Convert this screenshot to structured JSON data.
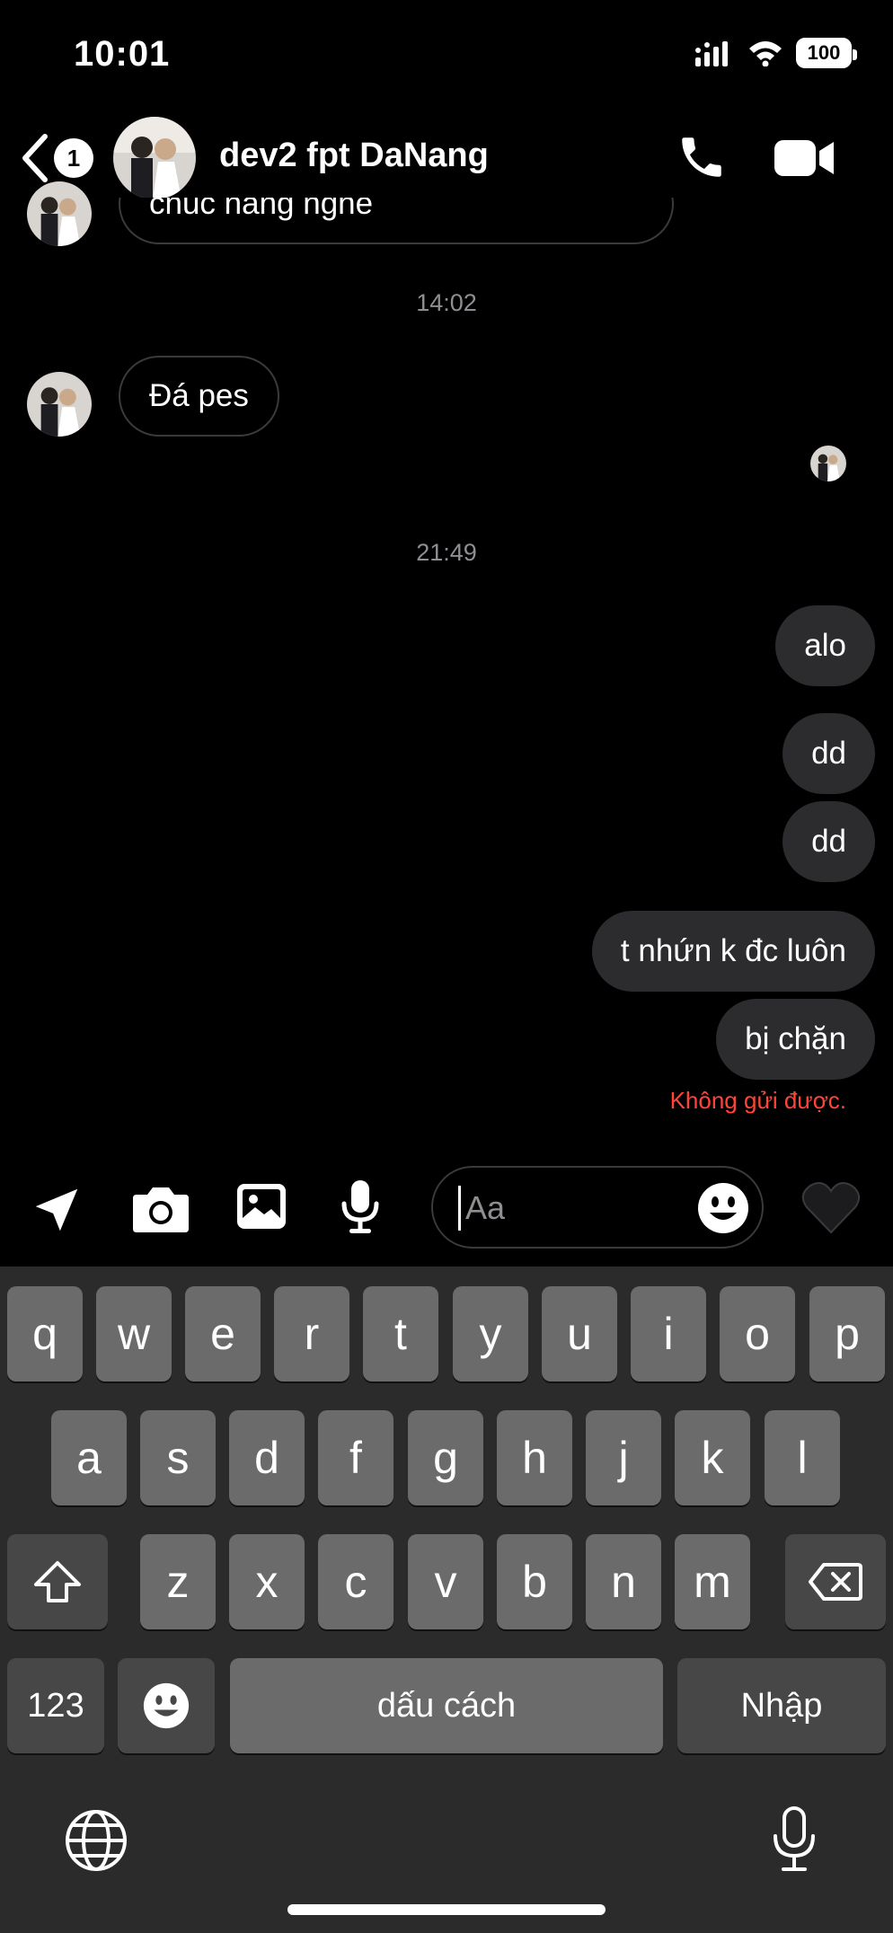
{
  "status_bar": {
    "time": "10:01",
    "battery": "100"
  },
  "header": {
    "back_count": "1",
    "contact_name": "dev2 fpt DaNang"
  },
  "messages": {
    "partial_text": "chuc nang nghe",
    "time_1": "14:02",
    "received_1": "Đá pes",
    "time_2": "21:49",
    "sent": [
      "alo",
      "dd",
      "dd",
      "t nhứn k đc luôn",
      "bị chặn"
    ],
    "error": "Không gửi được."
  },
  "composer": {
    "placeholder": "Aa"
  },
  "keyboard": {
    "row1": [
      "q",
      "w",
      "e",
      "r",
      "t",
      "y",
      "u",
      "i",
      "o",
      "p"
    ],
    "row2": [
      "a",
      "s",
      "d",
      "f",
      "g",
      "h",
      "j",
      "k",
      "l"
    ],
    "row3": [
      "z",
      "x",
      "c",
      "v",
      "b",
      "n",
      "m"
    ],
    "numbers": "123",
    "space": "dấu cách",
    "enter": "Nhập"
  },
  "colors": {
    "background": "#000000",
    "bubble_sent": "#2c2c2e",
    "error": "#ff453a",
    "keyboard": "#2b2b2b"
  }
}
